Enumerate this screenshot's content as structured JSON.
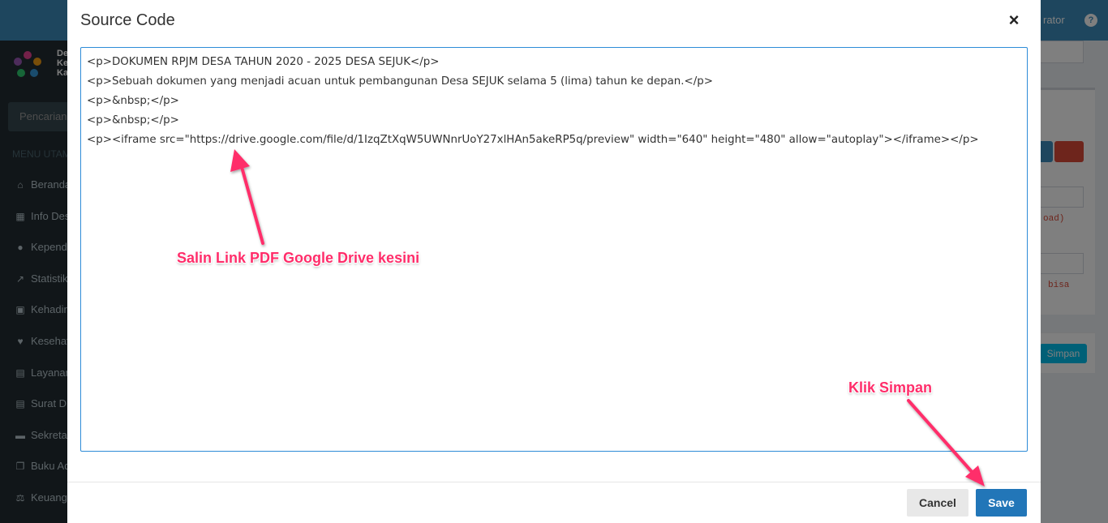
{
  "background": {
    "header_user": "rator",
    "help_icon": "?",
    "brand_lines": [
      "De",
      "Ke",
      "Ka"
    ],
    "search_placeholder": "Pencarian",
    "menu_title": "MENU UTAMA",
    "menu_items": [
      {
        "label": "Beranda",
        "icon": "home-icon"
      },
      {
        "label": "Info Desa",
        "icon": "building-icon"
      },
      {
        "label": "Kependudukan",
        "icon": "users-icon"
      },
      {
        "label": "Statistik",
        "icon": "chart-line-icon"
      },
      {
        "label": "Kehadiran",
        "icon": "calendar-check-icon"
      },
      {
        "label": "Kesehatan",
        "icon": "heartbeat-icon"
      },
      {
        "label": "Layanan",
        "icon": "book-icon"
      },
      {
        "label": "Surat Dinas",
        "icon": "book-icon"
      },
      {
        "label": "Sekretariat",
        "icon": "archive-icon"
      },
      {
        "label": "Buku Administrasi",
        "icon": "copy-icon"
      },
      {
        "label": "Keuangan",
        "icon": "balance-scale-icon"
      }
    ],
    "hint_1": "oad)",
    "hint_2": "bisa",
    "simpan_label": "Simpan"
  },
  "modal": {
    "title": "Source Code",
    "close_icon": "×",
    "code_lines": [
      "<p>DOKUMEN RPJM DESA TAHUN 2020 - 2025 DESA SEJUK</p>",
      "<p>Sebuah dokumen yang menjadi acuan untuk pembangunan Desa SEJUK selama 5 (lima) tahun ke depan.</p>",
      "<p>&nbsp;</p>",
      "<p>&nbsp;</p>",
      "<p><iframe src=\"https://drive.google.com/file/d/1IzqZtXqW5UWNnrUoY27xlHAn5akeRP5q/preview\" width=\"640\" height=\"480\" allow=\"autoplay\"></iframe></p>"
    ],
    "cancel_label": "Cancel",
    "save_label": "Save"
  },
  "annotations": {
    "paste_hint": "Salin Link PDF Google Drive kesini",
    "save_hint": "Klik Simpan",
    "color": "#ff2d6a"
  }
}
